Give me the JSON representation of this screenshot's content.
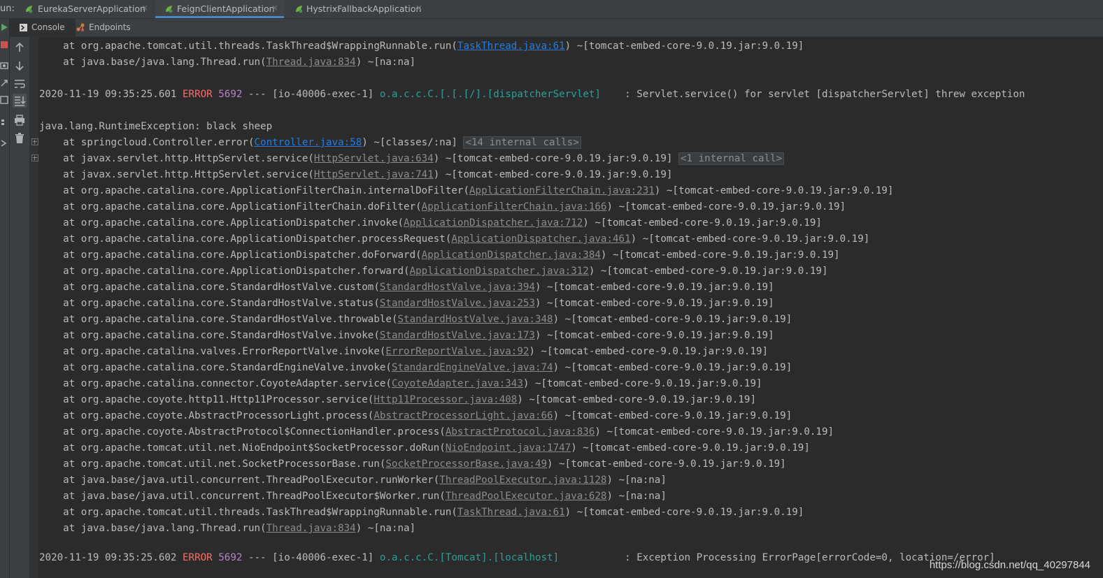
{
  "run_bar": {
    "label": "un:",
    "tabs": [
      {
        "label": "EurekaServerApplication",
        "active": false
      },
      {
        "label": "FeignClientApplication",
        "active": true
      },
      {
        "label": "HystrixFallbackApplication",
        "active": false
      }
    ],
    "close_glyph": "×"
  },
  "console_tabs": {
    "console_label": "Console",
    "endpoints_label": "Endpoints"
  },
  "log": {
    "pre1": {
      "prefix": "    at org.apache.tomcat.util.threads.TaskThread$WrappingRunnable.run(",
      "link": "TaskThread.java:61",
      "suffix": ") ~[tomcat-embed-core-9.0.19.jar:9.0.19]"
    },
    "pre2": {
      "prefix": "    at java.base/java.lang.Thread.run(",
      "link": "Thread.java:834",
      "suffix": ") ~[na:na]"
    },
    "err1": {
      "ts": "2020-11-19 09:35:25.601 ",
      "level": "ERROR",
      "pid": " 5692",
      "mid": " --- [io-40006-exec-1] ",
      "logger": "o.a.c.c.C.[.[.[/].[dispatcherServlet]",
      "msg": "    : Servlet.service() for servlet [dispatcherServlet] threw exception"
    },
    "exception": "java.lang.RuntimeException: black sheep",
    "l1": {
      "prefix": "    at springcloud.Controller.error(",
      "link": "Controller.java:58",
      "suffix": ") ~[classes/:na]",
      "pill": "<14 internal calls>"
    },
    "l2": {
      "prefix": "    at javax.servlet.http.HttpServlet.service(",
      "link": "HttpServlet.java:634",
      "suffix": ") ~[tomcat-embed-core-9.0.19.jar:9.0.19]",
      "pill": "<1 internal call>"
    },
    "frames": [
      {
        "prefix": "    at javax.servlet.http.HttpServlet.service(",
        "link": "HttpServlet.java:741",
        "suffix": ") ~[tomcat-embed-core-9.0.19.jar:9.0.19]"
      },
      {
        "prefix": "    at org.apache.catalina.core.ApplicationFilterChain.internalDoFilter(",
        "link": "ApplicationFilterChain.java:231",
        "suffix": ") ~[tomcat-embed-core-9.0.19.jar:9.0.19]"
      },
      {
        "prefix": "    at org.apache.catalina.core.ApplicationFilterChain.doFilter(",
        "link": "ApplicationFilterChain.java:166",
        "suffix": ") ~[tomcat-embed-core-9.0.19.jar:9.0.19]"
      },
      {
        "prefix": "    at org.apache.catalina.core.ApplicationDispatcher.invoke(",
        "link": "ApplicationDispatcher.java:712",
        "suffix": ") ~[tomcat-embed-core-9.0.19.jar:9.0.19]"
      },
      {
        "prefix": "    at org.apache.catalina.core.ApplicationDispatcher.processRequest(",
        "link": "ApplicationDispatcher.java:461",
        "suffix": ") ~[tomcat-embed-core-9.0.19.jar:9.0.19]"
      },
      {
        "prefix": "    at org.apache.catalina.core.ApplicationDispatcher.doForward(",
        "link": "ApplicationDispatcher.java:384",
        "suffix": ") ~[tomcat-embed-core-9.0.19.jar:9.0.19]"
      },
      {
        "prefix": "    at org.apache.catalina.core.ApplicationDispatcher.forward(",
        "link": "ApplicationDispatcher.java:312",
        "suffix": ") ~[tomcat-embed-core-9.0.19.jar:9.0.19]"
      },
      {
        "prefix": "    at org.apache.catalina.core.StandardHostValve.custom(",
        "link": "StandardHostValve.java:394",
        "suffix": ") ~[tomcat-embed-core-9.0.19.jar:9.0.19]"
      },
      {
        "prefix": "    at org.apache.catalina.core.StandardHostValve.status(",
        "link": "StandardHostValve.java:253",
        "suffix": ") ~[tomcat-embed-core-9.0.19.jar:9.0.19]"
      },
      {
        "prefix": "    at org.apache.catalina.core.StandardHostValve.throwable(",
        "link": "StandardHostValve.java:348",
        "suffix": ") ~[tomcat-embed-core-9.0.19.jar:9.0.19]"
      },
      {
        "prefix": "    at org.apache.catalina.core.StandardHostValve.invoke(",
        "link": "StandardHostValve.java:173",
        "suffix": ") ~[tomcat-embed-core-9.0.19.jar:9.0.19]"
      },
      {
        "prefix": "    at org.apache.catalina.valves.ErrorReportValve.invoke(",
        "link": "ErrorReportValve.java:92",
        "suffix": ") ~[tomcat-embed-core-9.0.19.jar:9.0.19]"
      },
      {
        "prefix": "    at org.apache.catalina.core.StandardEngineValve.invoke(",
        "link": "StandardEngineValve.java:74",
        "suffix": ") ~[tomcat-embed-core-9.0.19.jar:9.0.19]"
      },
      {
        "prefix": "    at org.apache.catalina.connector.CoyoteAdapter.service(",
        "link": "CoyoteAdapter.java:343",
        "suffix": ") ~[tomcat-embed-core-9.0.19.jar:9.0.19]"
      },
      {
        "prefix": "    at org.apache.coyote.http11.Http11Processor.service(",
        "link": "Http11Processor.java:408",
        "suffix": ") ~[tomcat-embed-core-9.0.19.jar:9.0.19]"
      },
      {
        "prefix": "    at org.apache.coyote.AbstractProcessorLight.process(",
        "link": "AbstractProcessorLight.java:66",
        "suffix": ") ~[tomcat-embed-core-9.0.19.jar:9.0.19]"
      },
      {
        "prefix": "    at org.apache.coyote.AbstractProtocol$ConnectionHandler.process(",
        "link": "AbstractProtocol.java:836",
        "suffix": ") ~[tomcat-embed-core-9.0.19.jar:9.0.19]"
      },
      {
        "prefix": "    at org.apache.tomcat.util.net.NioEndpoint$SocketProcessor.doRun(",
        "link": "NioEndpoint.java:1747",
        "suffix": ") ~[tomcat-embed-core-9.0.19.jar:9.0.19]"
      },
      {
        "prefix": "    at org.apache.tomcat.util.net.SocketProcessorBase.run(",
        "link": "SocketProcessorBase.java:49",
        "suffix": ") ~[tomcat-embed-core-9.0.19.jar:9.0.19]"
      },
      {
        "prefix": "    at java.base/java.util.concurrent.ThreadPoolExecutor.runWorker(",
        "link": "ThreadPoolExecutor.java:1128",
        "suffix": ") ~[na:na]"
      },
      {
        "prefix": "    at java.base/java.util.concurrent.ThreadPoolExecutor$Worker.run(",
        "link": "ThreadPoolExecutor.java:628",
        "suffix": ") ~[na:na]"
      },
      {
        "prefix": "    at org.apache.tomcat.util.threads.TaskThread$WrappingRunnable.run(",
        "link": "TaskThread.java:61",
        "suffix": ") ~[tomcat-embed-core-9.0.19.jar:9.0.19]"
      },
      {
        "prefix": "    at java.base/java.lang.Thread.run(",
        "link": "Thread.java:834",
        "suffix": ") ~[na:na]"
      }
    ],
    "err2": {
      "ts": "2020-11-19 09:35:25.602 ",
      "level": "ERROR",
      "pid": " 5692",
      "mid": " --- [io-40006-exec-1] ",
      "logger": "o.a.c.c.C.[Tomcat].[localhost]",
      "msg": "           : Exception Processing ErrorPage[errorCode=0, location=/error]"
    }
  },
  "watermark": "https://blog.csdn.net/qq_40297844",
  "colors": {
    "background": "#2b2b2b",
    "text": "#bbbbbb",
    "link": "#287bde",
    "error": "#ff6b68",
    "pid": "#b285c7",
    "logger": "#2aa198"
  }
}
